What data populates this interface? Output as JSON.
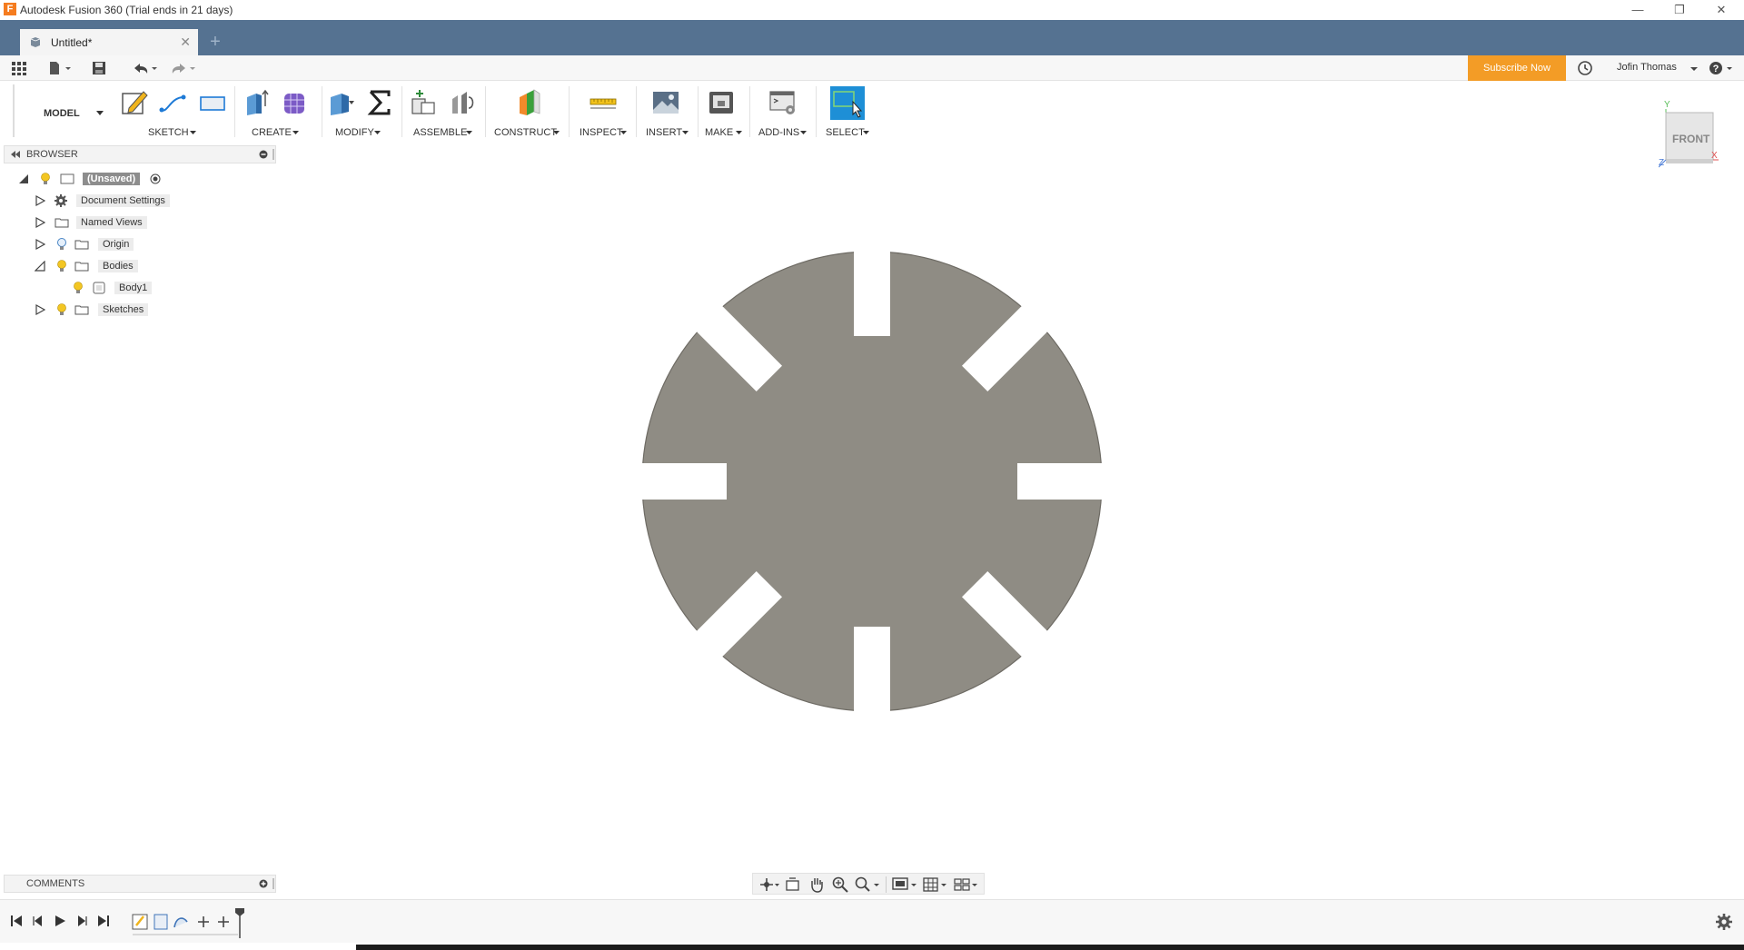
{
  "window": {
    "title": "Autodesk Fusion 360 (Trial ends in 21 days)",
    "app_icon_letter": "F",
    "controls": [
      "—",
      "❐",
      "✕"
    ]
  },
  "tabs": [
    {
      "label": "Untitled*",
      "close": "✕"
    }
  ],
  "new_tab": "+",
  "quick_access": {
    "subscribe_label": "Subscribe Now",
    "user_name": "Jofin Thomas",
    "help": "?"
  },
  "toolbar": {
    "workspace": "MODEL",
    "groups": [
      {
        "label": "SKETCH"
      },
      {
        "label": "CREATE"
      },
      {
        "label": "MODIFY"
      },
      {
        "label": "ASSEMBLE"
      },
      {
        "label": "CONSTRUCT"
      },
      {
        "label": "INSPECT"
      },
      {
        "label": "INSERT"
      },
      {
        "label": "MAKE"
      },
      {
        "label": "ADD-INS"
      },
      {
        "label": "SELECT"
      }
    ]
  },
  "browser": {
    "title": "BROWSER",
    "root": "(Unsaved)",
    "items": [
      {
        "label": "Document Settings"
      },
      {
        "label": "Named Views"
      },
      {
        "label": "Origin"
      },
      {
        "label": "Bodies"
      },
      {
        "label": "Body1"
      },
      {
        "label": "Sketches"
      }
    ]
  },
  "viewcube": {
    "face": "FRONT",
    "axis_y": "Y",
    "axis_x": "X",
    "axis_z": "Z"
  },
  "comments": {
    "title": "COMMENTS"
  },
  "colors": {
    "tabbar": "#557291",
    "accent": "#1e8fd6",
    "subscribe": "#f39c26",
    "body_fill": "#8f8c84"
  }
}
